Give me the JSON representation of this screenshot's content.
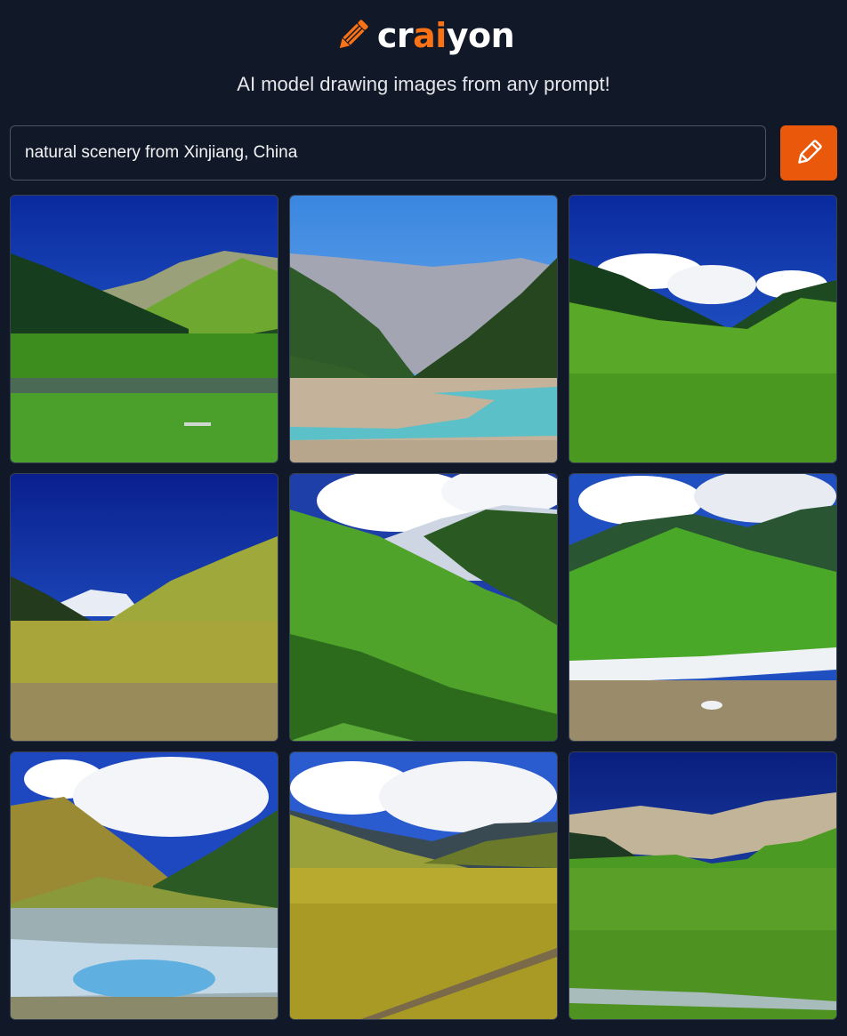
{
  "app": {
    "logo_parts": [
      "cr",
      "ai",
      "yon"
    ],
    "tagline": "AI model drawing images from any prompt!",
    "accent_color": "#f97316",
    "background_color": "#111827"
  },
  "prompt": {
    "value": "natural scenery from Xinjiang, China",
    "placeholder": ""
  },
  "draw_button": {
    "icon": "pencil-icon",
    "color": "#ea580c"
  },
  "logo_icon": "pencil-icon",
  "results": [
    {
      "name": "result-image-1",
      "scene": "green valley, forested hills, rocky peaks, blue sky"
    },
    {
      "name": "result-image-2",
      "scene": "grey mountains, pine slopes, turquoise river"
    },
    {
      "name": "result-image-3",
      "scene": "grassland meadow, pine ridge, white clouds"
    },
    {
      "name": "result-image-4",
      "scene": "yellow-green hills, snowy peak, deep blue sky"
    },
    {
      "name": "result-image-5",
      "scene": "green rolling hills with shadows, clouds"
    },
    {
      "name": "result-image-6",
      "scene": "green meadow, white river, cloudy sky"
    },
    {
      "name": "result-image-7",
      "scene": "hills, lake reflecting sky, big clouds"
    },
    {
      "name": "result-image-8",
      "scene": "golden grassland valley, clouds, road"
    },
    {
      "name": "result-image-9",
      "scene": "green plain, tan rocky ridge, dark blue sky"
    }
  ]
}
